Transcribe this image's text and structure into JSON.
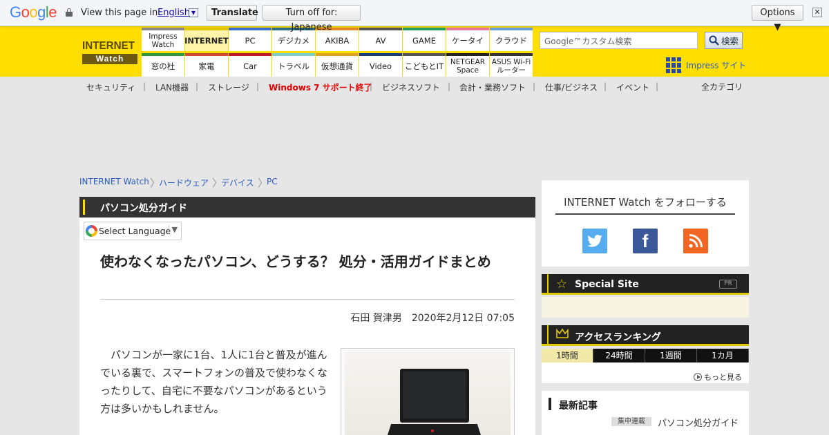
{
  "translate_bar": {
    "logo": "Google",
    "prompt": "View this page in:",
    "language": "English",
    "translate_button": "Translate",
    "turn_off_button": "Turn off for: Japanese",
    "options_button": "Options ▼",
    "close": "✕"
  },
  "site": {
    "logo_top": "INTERNET",
    "logo_bottom": "Watch",
    "categories_top": [
      "Impress Watch",
      "INTERNET",
      "PC",
      "デジカメ",
      "AKIBA",
      "AV",
      "GAME",
      "ケータイ",
      "クラウド"
    ],
    "categories_bottom": [
      "窓の杜",
      "家電",
      "Car",
      "トラベル",
      "仮想通貨",
      "Video",
      "こどもとIT",
      "NETGEAR Space",
      "ASUS Wi-Fiルーター"
    ],
    "active_category": "INTERNET",
    "category_colors_top": [
      "#8a8a8a",
      "#e0c800",
      "#3a6fd0",
      "#2f6f8a",
      "#e08a2a",
      "#555555",
      "#22a060",
      "#e67aa0",
      "#6aa0dd"
    ],
    "category_colors_bottom": [
      "#2e9a3a",
      "#d04a2a",
      "#c01a2a",
      "#7ad0c8",
      "#e0a020",
      "#1a3a7a",
      "#555555",
      "#222222",
      "#333333"
    ],
    "search_placeholder": "Google™カスタム検索",
    "search_button": "検索",
    "impress_link": "Impress サイト"
  },
  "subnav": {
    "items": [
      "セキュリティ",
      "LAN機器",
      "ストレージ",
      "Windows 7 サポート終了",
      "ビジネスソフト",
      "会計・業務ソフト",
      "仕事/ビジネス",
      "イベント"
    ],
    "highlight": "Windows 7 サポート終了",
    "all_categories": "全カテゴリ"
  },
  "breadcrumb": [
    "INTERNET Watch",
    "ハードウェア",
    "デバイス",
    "PC"
  ],
  "article": {
    "series": "パソコン処分ガイド",
    "language_select": "Select Language",
    "headline": "使わなくなったパソコン、どうする？ 処分・活用ガイドまとめ",
    "author": "石田 賀津男",
    "date": "2020年2月12日 07:05",
    "body": "パソコンが一家に1台、1人に1台と普及が進んでいる裏で、スマートフォンの普及で使わなくなったりして、自宅に不要なパソコンがあるという方は多いかもしれません。"
  },
  "sidebar": {
    "follow_title": "INTERNET Watch をフォローする",
    "social": [
      "twitter-icon",
      "facebook-icon",
      "rss-icon"
    ],
    "special_site": "Special Site",
    "pr": "PR",
    "ranking_title": "アクセスランキング",
    "ranking_tabs": [
      "1時間",
      "24時間",
      "1週間",
      "1カ月"
    ],
    "more": "もっと見る",
    "latest_title": "最新記事",
    "latest_badge": "集中連載",
    "latest_item": "パソコン処分ガイド"
  },
  "colors": {
    "brand_yellow": "#ffde00",
    "link_blue": "#2a5bbf",
    "highlight_red": "#e00000"
  }
}
